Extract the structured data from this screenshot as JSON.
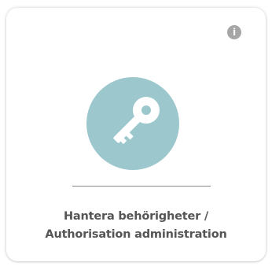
{
  "tile": {
    "title_line1": "Hantera behörigheter /",
    "title_line2": "Authorisation administration",
    "info_glyph": "i",
    "icon": "key-icon",
    "info_icon": "info-icon"
  },
  "colors": {
    "circle": "#9cc7cd",
    "info": "#a6a6a6",
    "text": "#555555",
    "divider": "#8a8a8a"
  }
}
